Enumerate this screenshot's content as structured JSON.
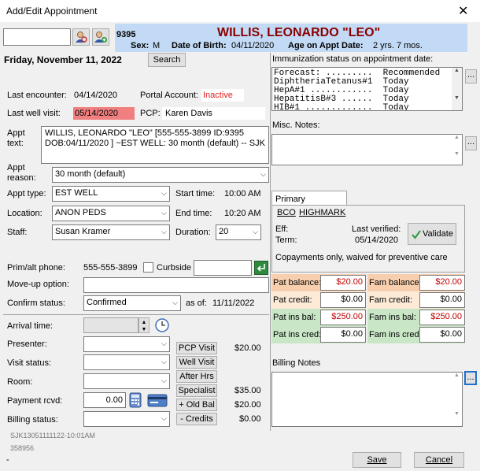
{
  "window": {
    "title": "Add/Edit Appointment",
    "close_glyph": "✕"
  },
  "patient": {
    "id": "9395",
    "name": "WILLIS, LEONARDO \"LEO\"",
    "sex_label": "Sex:",
    "sex": "M",
    "dob_label": "Date of Birth:",
    "dob": "04/11/2020",
    "age_label": "Age on Appt Date:",
    "age": "2 yrs. 7 mos."
  },
  "date": {
    "value": "Friday, November 11, 2022",
    "search_label": "Search"
  },
  "encounter": {
    "last_encounter_label": "Last encounter:",
    "last_encounter": "04/14/2020",
    "portal_label": "Portal Account:",
    "portal_status": "Inactive",
    "last_well_label": "Last well visit:",
    "last_well": "05/14/2020",
    "pcp_label": "PCP:",
    "pcp": "Karen Davis"
  },
  "appt": {
    "text_label": "Appt text:",
    "text_value": "WILLIS, LEONARDO \"LEO\" [555-555-3899 ID:9395 DOB:04/11/2020 ] ~EST WELL: 30 month (default) -- SJK",
    "reason_label": "Appt reason:",
    "reason": "30 month (default)",
    "type_label": "Appt type:",
    "type": "EST WELL",
    "start_label": "Start time:",
    "start": "10:00 AM",
    "location_label": "Location:",
    "location": "ANON PEDS",
    "end_label": "End time:",
    "end": "10:20 AM",
    "staff_label": "Staff:",
    "staff": "Susan Kramer",
    "duration_label": "Duration:",
    "duration": "20"
  },
  "contact": {
    "phone_label": "Prim/alt phone:",
    "phone": "555-555-3899",
    "curbside_label": "Curbside",
    "moveup_label": "Move-up option:",
    "confirm_label": "Confirm status:",
    "confirm": "Confirmed",
    "asof_label": "as of:",
    "asof": "11/11/2022"
  },
  "visit": {
    "arrival_label": "Arrival time:",
    "presenter_label": "Presenter:",
    "status_label": "Visit status:",
    "room_label": "Room:",
    "payment_label": "Payment rcvd:",
    "payment": "0.00",
    "billing_label": "Billing status:"
  },
  "services": [
    {
      "label": "PCP Visit",
      "amount": "$20.00"
    },
    {
      "label": "Well Visit",
      "amount": ""
    },
    {
      "label": "After Hrs",
      "amount": ""
    },
    {
      "label": "Specialist",
      "amount": "$35.00"
    },
    {
      "label": "+ Old Bal",
      "amount": "$20.00"
    },
    {
      "label": "- Credits",
      "amount": "$0.00"
    }
  ],
  "footer_left": {
    "code": "SJK13051111122-10:01AM",
    "number": "358956",
    "dash": "-"
  },
  "immunization": {
    "label": "Immunization status on appointment date:",
    "lines": [
      "Forecast: .........  Recommended",
      "DiphtheriaTetanus#1  Today",
      "HepA#1 ............  Today",
      "HepatitisB#3 ......  Today",
      "HIB#1 .............  Today"
    ],
    "more_label": "..."
  },
  "misc": {
    "label": "Misc. Notes:",
    "more_label": "..."
  },
  "insurance": {
    "tab": "Primary Insurance",
    "carrier_code": "BCO",
    "carrier_name": "HIGHMARK",
    "eff_label": "Eff:",
    "term_label": "Term:",
    "verified_label": "Last verified:",
    "verified": "05/14/2020",
    "validate_label": "Validate",
    "copay_note": "Copayments only, waived for preventive care"
  },
  "balances": {
    "pat_balance_label": "Pat balance:",
    "pat_balance": "$20.00",
    "fam_balance_label": "Fam balance:",
    "fam_balance": "$20.00",
    "pat_credit_label": "Pat credit:",
    "pat_credit": "$0.00",
    "fam_credit_label": "Fam credit:",
    "fam_credit": "$0.00",
    "pat_ins_bal_label": "Pat ins bal:",
    "pat_ins_bal": "$250.00",
    "fam_ins_bal_label": "Fam ins bal:",
    "fam_ins_bal": "$250.00",
    "pat_ins_cred_label": "Pat ins cred:",
    "pat_ins_cred": "$0.00",
    "fam_ins_cred_label": "Fam ins cred:",
    "fam_ins_cred": "$0.00",
    "colors": {
      "balance": "#f8cfae",
      "credit": "#fdebd8",
      "ins": "#c9e6c7"
    }
  },
  "billing_notes": {
    "label": "Billing Notes",
    "more_label": "..."
  },
  "actions": {
    "save": "Save",
    "cancel": "Cancel"
  },
  "icons": [
    "patient-search-icon",
    "patient-add-icon",
    "clock-icon",
    "calculator-icon",
    "credit-card-icon",
    "green-arrow-icon",
    "check-icon"
  ]
}
